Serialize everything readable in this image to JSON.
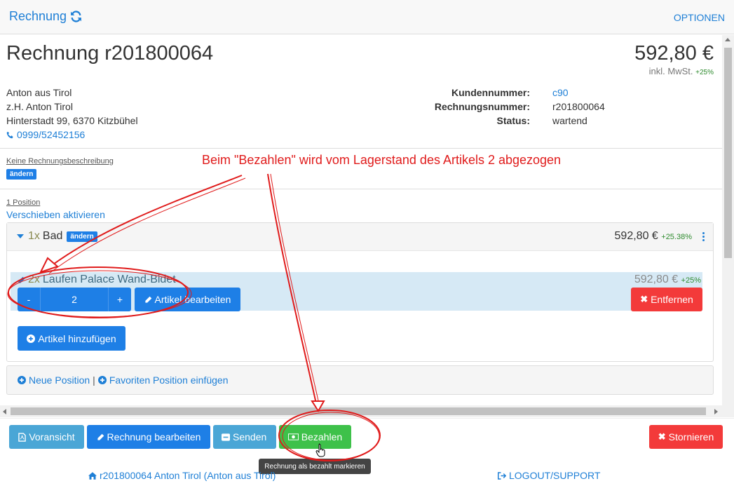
{
  "header": {
    "title": "Rechnung",
    "options": "OPTIONEN"
  },
  "invoice": {
    "title": "Rechnung r201800064",
    "total": "592,80 €",
    "vat_label": "inkl. MwSt.",
    "vat_rate": "+25%"
  },
  "customer": {
    "name": "Anton aus Tirol",
    "contact": "z.H. Anton Tirol",
    "address": "Hinterstadt 99, 6370 Kitzbühel",
    "phone": "0999/52452156"
  },
  "meta": {
    "customer_no_label": "Kundennummer:",
    "customer_no": "c90",
    "invoice_no_label": "Rechnungsnummer:",
    "invoice_no": "r201800064",
    "status_label": "Status:",
    "status": "wartend"
  },
  "description": {
    "text": "Keine Rechnungsbeschreibung",
    "edit": "ändern"
  },
  "positions": {
    "count": "1 Position",
    "reorder": "Verschieben aktivieren",
    "item": {
      "qty": "1x",
      "name": "Bad",
      "edit": "ändern",
      "price": "592,80 €",
      "margin": "+25.38%",
      "article": {
        "qty": "2x",
        "name": "Laufen Palace Wand-Bidet",
        "price": "592,80 €",
        "vat": "+25%",
        "minus": "-",
        "value": "2",
        "plus": "+",
        "edit": "Artikel bearbeiten",
        "remove": "Entfernen"
      },
      "add_article": "Artikel hinzufügen"
    },
    "new_position": "Neue Position",
    "separator": "|",
    "favorite_position": "Favoriten Position einfügen"
  },
  "annotation": "Beim \"Bezahlen\" wird vom Lagerstand des Artikels 2 abgezogen",
  "actions": {
    "preview": "Voransicht",
    "edit": "Rechnung bearbeiten",
    "send": "Senden",
    "pay": "Bezahlen",
    "cancel": "Stornieren",
    "tooltip": "Rechnung als bezahlt markieren"
  },
  "footer": {
    "invoice_link": "r201800064 Anton Tirol (Anton aus Tirol)",
    "logout": "LOGOUT/SUPPORT"
  },
  "colors": {
    "primary": "#1e7fe6",
    "success": "#3ec14a",
    "danger": "#f33a3a",
    "info": "#4aa6d6",
    "annotation": "#e01b1b"
  }
}
